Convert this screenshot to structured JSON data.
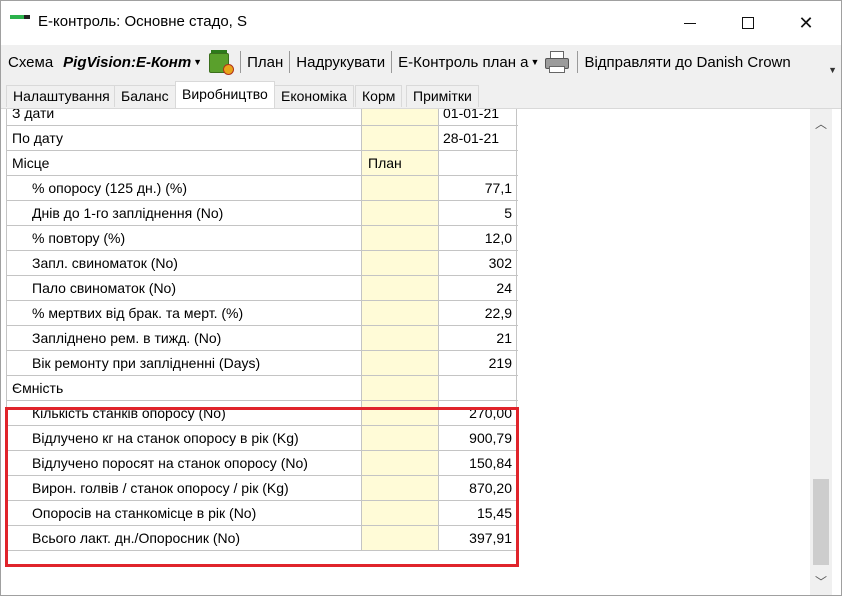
{
  "window": {
    "title": "Е-контроль: Основне стадо, S"
  },
  "toolbar": {
    "scheme_label": "Схема",
    "scheme_value": "PigVision:E-Конт",
    "plan_label": "План",
    "print_label": "Надрукувати",
    "report_value": "E-Контроль план а",
    "send_label": "Відправляти до Danish Crown"
  },
  "tabs": [
    {
      "label": "Налаштування"
    },
    {
      "label": "Баланс"
    },
    {
      "label": "Виробництво"
    },
    {
      "label": "Економіка"
    },
    {
      "label": "Корм"
    },
    {
      "label": "Примітки"
    }
  ],
  "active_tab": "Виробництво",
  "grid": {
    "rows": [
      {
        "label": "З дати",
        "plan": "",
        "value": "01-01-21"
      },
      {
        "label": "По дату",
        "plan": "",
        "value": "28-01-21"
      },
      {
        "label": "Місце",
        "plan": "План",
        "value": ""
      },
      {
        "label": "% опоросу (125 дн.) (%)",
        "plan": "",
        "value": "77,1"
      },
      {
        "label": "Днів до 1-го запліднення (No)",
        "plan": "",
        "value": "5"
      },
      {
        "label": "% повтору (%)",
        "plan": "",
        "value": "12,0"
      },
      {
        "label": "Запл. свиноматок (No)",
        "plan": "",
        "value": "302"
      },
      {
        "label": "Пало свиноматок (No)",
        "plan": "",
        "value": "24"
      },
      {
        "label": "% мертвих від брак. та мерт. (%)",
        "plan": "",
        "value": "22,9"
      },
      {
        "label": "Запліднено рем. в тижд. (No)",
        "plan": "",
        "value": "21"
      },
      {
        "label": "Вік ремонту при заплідненні (Days)",
        "plan": "",
        "value": "219"
      },
      {
        "label": "Ємність",
        "plan": "",
        "value": ""
      },
      {
        "label": "Кількість станків опоросу (No)",
        "plan": "",
        "value": "270,00"
      },
      {
        "label": "Відлучено кг на станок опоросу в рік (Kg)",
        "plan": "",
        "value": "900,79"
      },
      {
        "label": "Відлучено поросят на станок опоросу (No)",
        "plan": "",
        "value": "150,84"
      },
      {
        "label": "Вирон. голвів / станок опоросу / рік (Kg)",
        "plan": "",
        "value": "870,20"
      },
      {
        "label": "Опоросів на станкомісце в рік (No)",
        "plan": "",
        "value": "15,45"
      },
      {
        "label": "Всього лакт. дн./Опоросник (No)",
        "plan": "",
        "value": "397,91"
      }
    ]
  },
  "colors": {
    "plan_column_bg": "#fffbd7",
    "highlight_border": "#e0242b"
  }
}
